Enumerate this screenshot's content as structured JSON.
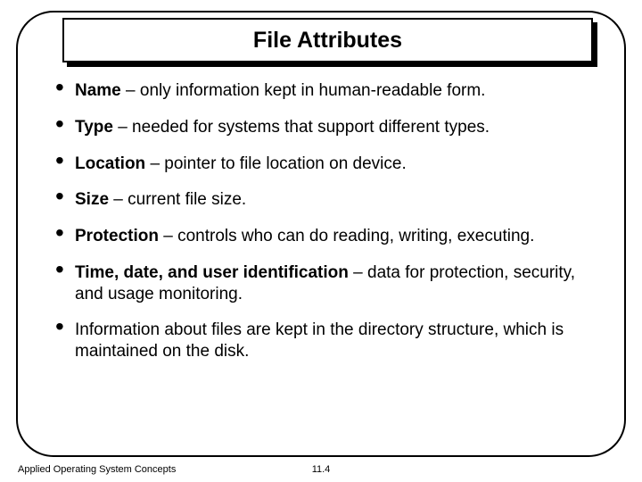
{
  "title": "File Attributes",
  "bullets": [
    {
      "bold": "Name",
      "rest": " – only information kept in human-readable form."
    },
    {
      "bold": "Type",
      "rest": " – needed for systems that support different types."
    },
    {
      "bold": "Location",
      "rest": " – pointer to file location on device."
    },
    {
      "bold": "Size",
      "rest": " – current file size."
    },
    {
      "bold": "Protection",
      "rest": " – controls who can do reading, writing, executing."
    },
    {
      "bold": "Time, date, and user identification",
      "rest": " – data for protection, security, and usage monitoring."
    },
    {
      "bold": "",
      "rest": "Information about files are kept in the directory structure, which is maintained on the disk."
    }
  ],
  "footer": {
    "left": "Applied Operating System Concepts",
    "center": "11.4"
  }
}
